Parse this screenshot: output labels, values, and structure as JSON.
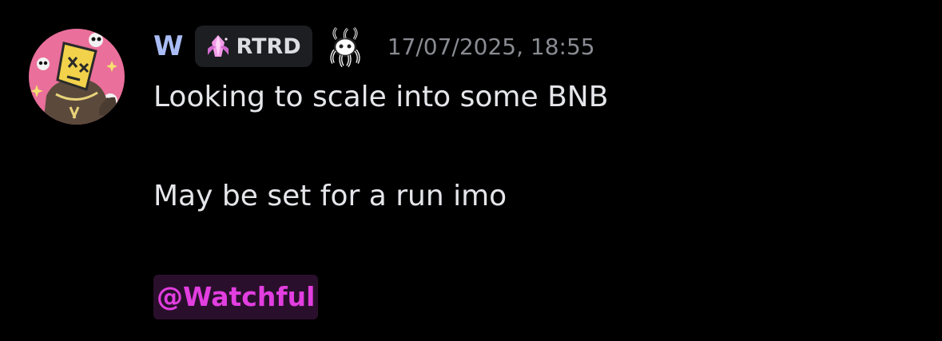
{
  "message": {
    "author": {
      "name": "W",
      "name_color": "#a9bcf5",
      "avatar_icon": "cartoon-avatar-icon"
    },
    "clan_tag": {
      "icon": "pink-crystal-icon",
      "label": "RTRD"
    },
    "badge_icon": "octopus-badge-icon",
    "timestamp": "17/07/2025, 18:55",
    "lines": [
      "Looking to scale into some BNB",
      "May be set for a run imo"
    ],
    "mention": {
      "label": "@Watchful",
      "color": "#e23ee0"
    }
  }
}
